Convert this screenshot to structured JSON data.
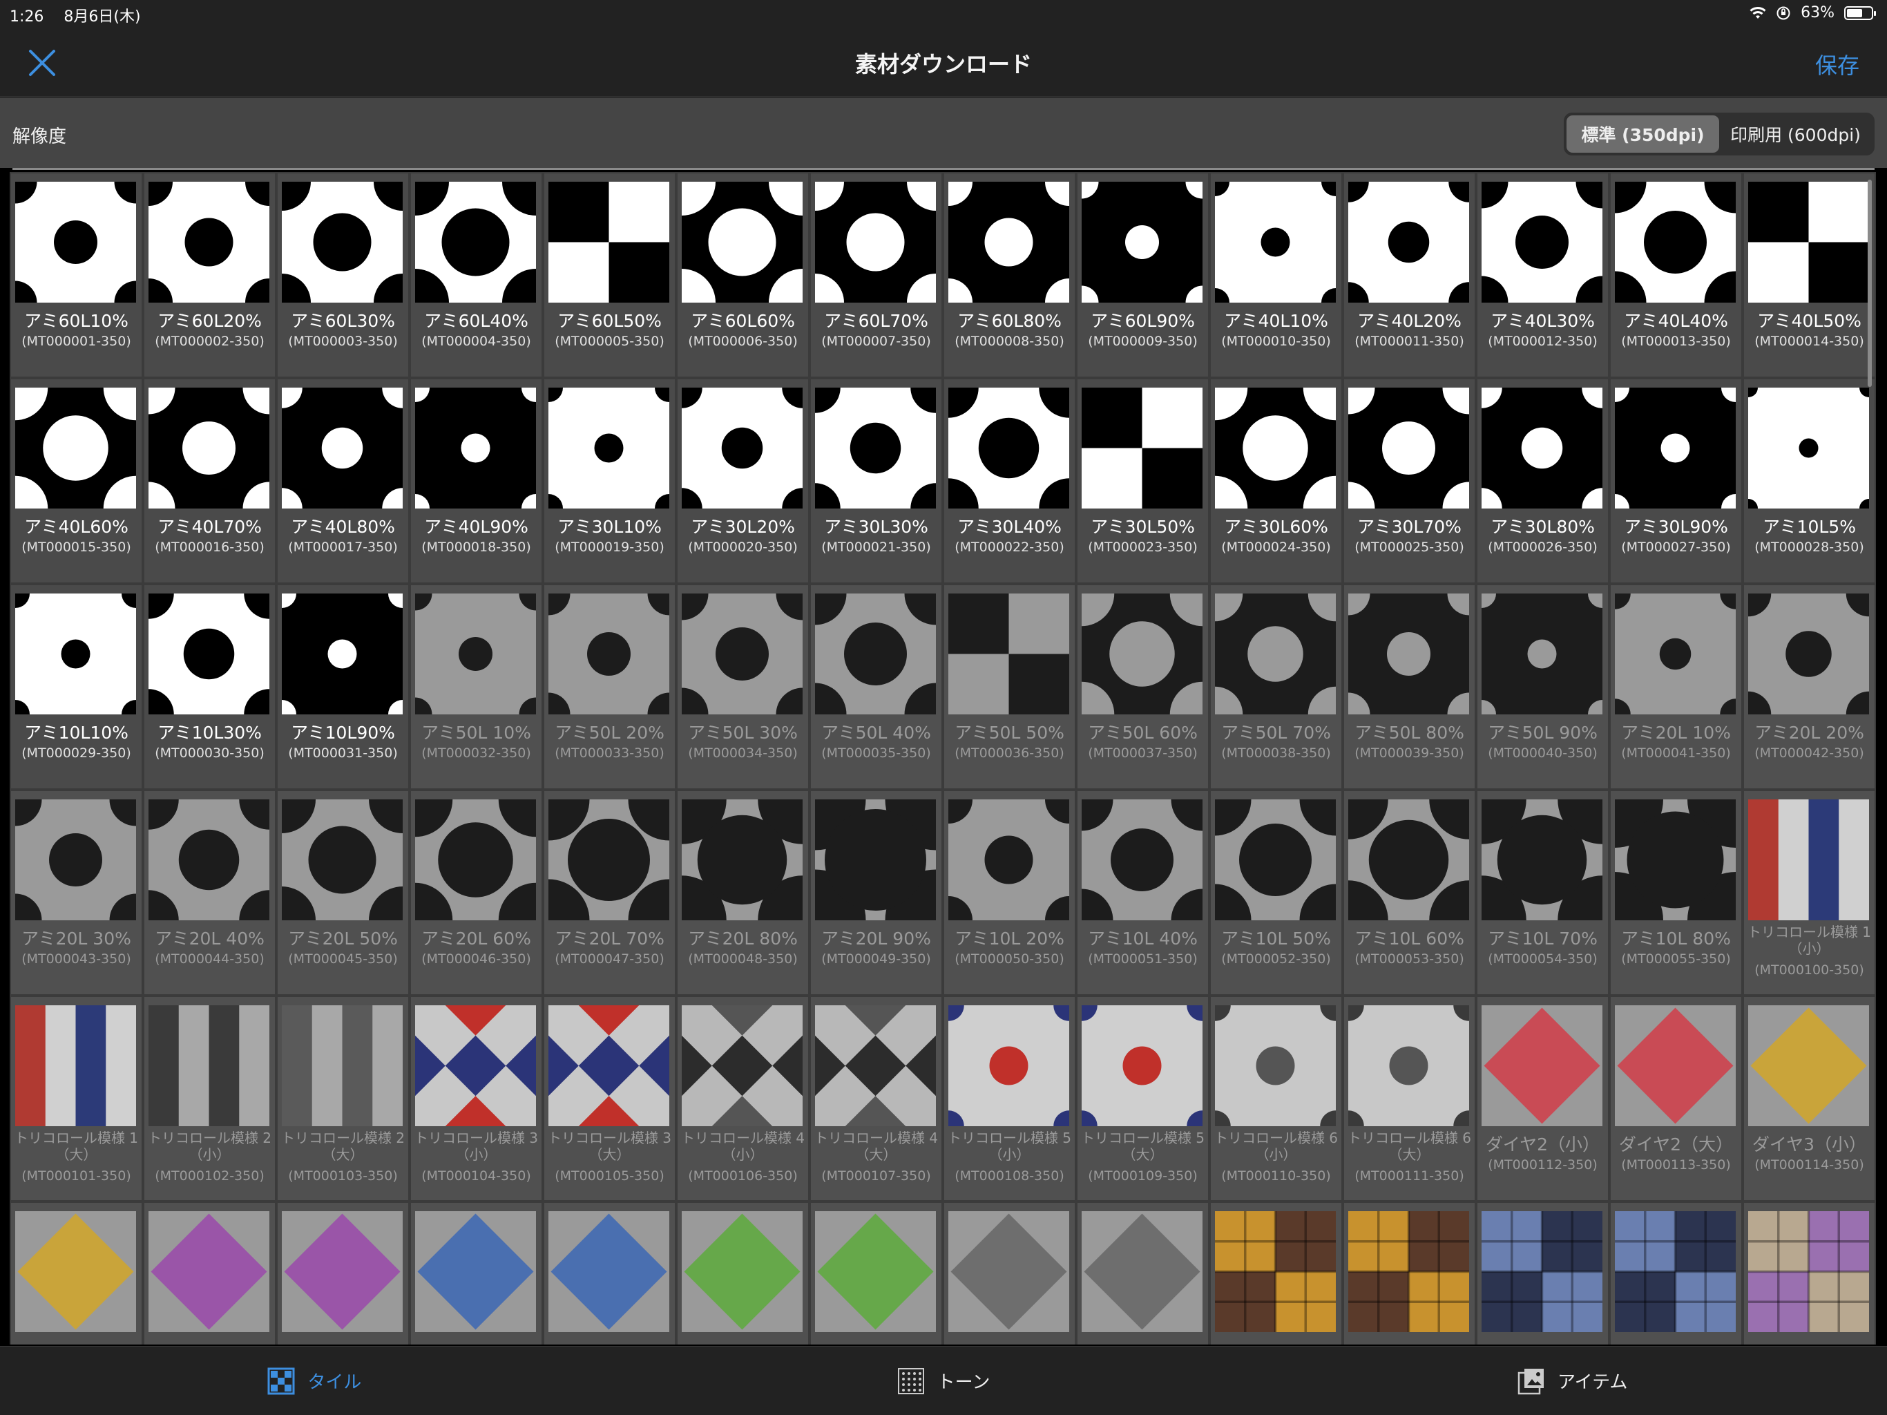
{
  "status": {
    "time": "1:26",
    "date": "8月6日(木)",
    "battery": "63%"
  },
  "nav": {
    "title": "素材ダウンロード",
    "save": "保存"
  },
  "resolution": {
    "label": "解像度",
    "options": [
      "標準 (350dpi)",
      "印刷用 (600dpi)"
    ],
    "selected": 0
  },
  "tabs": [
    {
      "label": "タイル",
      "icon": "tile-icon",
      "active": true
    },
    {
      "label": "トーン",
      "icon": "tone-icon",
      "active": false
    },
    {
      "label": "アイテム",
      "icon": "item-icon",
      "active": false
    }
  ],
  "tiles": [
    {
      "name": "アミ60L10%",
      "code": "(MT000001-350)",
      "p": "ami",
      "bg": "#fff",
      "fg": "#000",
      "r": 0.18,
      "dim": false
    },
    {
      "name": "アミ60L20%",
      "code": "(MT000002-350)",
      "p": "ami",
      "bg": "#fff",
      "fg": "#000",
      "r": 0.2,
      "dim": false
    },
    {
      "name": "アミ60L30%",
      "code": "(MT000003-350)",
      "p": "ami",
      "bg": "#fff",
      "fg": "#000",
      "r": 0.24,
      "dim": false
    },
    {
      "name": "アミ60L40%",
      "code": "(MT000004-350)",
      "p": "ami",
      "bg": "#fff",
      "fg": "#000",
      "r": 0.28,
      "dim": false
    },
    {
      "name": "アミ60L50%",
      "code": "(MT000005-350)",
      "p": "check",
      "bg": "#fff",
      "fg": "#000",
      "r": 0,
      "dim": false
    },
    {
      "name": "アミ60L60%",
      "code": "(MT000006-350)",
      "p": "ami",
      "bg": "#000",
      "fg": "#fff",
      "r": 0.28,
      "dim": false
    },
    {
      "name": "アミ60L70%",
      "code": "(MT000007-350)",
      "p": "ami",
      "bg": "#000",
      "fg": "#fff",
      "r": 0.24,
      "dim": false
    },
    {
      "name": "アミ60L80%",
      "code": "(MT000008-350)",
      "p": "ami",
      "bg": "#000",
      "fg": "#fff",
      "r": 0.2,
      "dim": false
    },
    {
      "name": "アミ60L90%",
      "code": "(MT000009-350)",
      "p": "ami",
      "bg": "#000",
      "fg": "#fff",
      "r": 0.14,
      "dim": false
    },
    {
      "name": "アミ40L10%",
      "code": "(MT000010-350)",
      "p": "ami",
      "bg": "#fff",
      "fg": "#000",
      "r": 0.12,
      "dim": false
    },
    {
      "name": "アミ40L20%",
      "code": "(MT000011-350)",
      "p": "ami",
      "bg": "#fff",
      "fg": "#000",
      "r": 0.17,
      "dim": false
    },
    {
      "name": "アミ40L30%",
      "code": "(MT000012-350)",
      "p": "ami",
      "bg": "#fff",
      "fg": "#000",
      "r": 0.22,
      "dim": false
    },
    {
      "name": "アミ40L40%",
      "code": "(MT000013-350)",
      "p": "ami",
      "bg": "#fff",
      "fg": "#000",
      "r": 0.26,
      "dim": false
    },
    {
      "name": "アミ40L50%",
      "code": "(MT000014-350)",
      "p": "check",
      "bg": "#fff",
      "fg": "#000",
      "r": 0,
      "dim": false
    },
    {
      "name": "アミ40L60%",
      "code": "(MT000015-350)",
      "p": "ami",
      "bg": "#000",
      "fg": "#fff",
      "r": 0.27,
      "dim": false
    },
    {
      "name": "アミ40L70%",
      "code": "(MT000016-350)",
      "p": "ami",
      "bg": "#000",
      "fg": "#fff",
      "r": 0.22,
      "dim": false
    },
    {
      "name": "アミ40L80%",
      "code": "(MT000017-350)",
      "p": "ami",
      "bg": "#000",
      "fg": "#fff",
      "r": 0.17,
      "dim": false
    },
    {
      "name": "アミ40L90%",
      "code": "(MT000018-350)",
      "p": "ami",
      "bg": "#000",
      "fg": "#fff",
      "r": 0.12,
      "dim": false
    },
    {
      "name": "アミ30L10%",
      "code": "(MT000019-350)",
      "p": "ami",
      "bg": "#fff",
      "fg": "#000",
      "r": 0.12,
      "dim": false
    },
    {
      "name": "アミ30L20%",
      "code": "(MT000020-350)",
      "p": "ami",
      "bg": "#fff",
      "fg": "#000",
      "r": 0.17,
      "dim": false
    },
    {
      "name": "アミ30L30%",
      "code": "(MT000021-350)",
      "p": "ami",
      "bg": "#fff",
      "fg": "#000",
      "r": 0.21,
      "dim": false
    },
    {
      "name": "アミ30L40%",
      "code": "(MT000022-350)",
      "p": "ami",
      "bg": "#fff",
      "fg": "#000",
      "r": 0.25,
      "dim": false
    },
    {
      "name": "アミ30L50%",
      "code": "(MT000023-350)",
      "p": "check",
      "bg": "#fff",
      "fg": "#000",
      "r": 0,
      "dim": false
    },
    {
      "name": "アミ30L60%",
      "code": "(MT000024-350)",
      "p": "ami",
      "bg": "#000",
      "fg": "#fff",
      "r": 0.27,
      "dim": false
    },
    {
      "name": "アミ30L70%",
      "code": "(MT000025-350)",
      "p": "ami",
      "bg": "#000",
      "fg": "#fff",
      "r": 0.22,
      "dim": false
    },
    {
      "name": "アミ30L80%",
      "code": "(MT000026-350)",
      "p": "ami",
      "bg": "#000",
      "fg": "#fff",
      "r": 0.17,
      "dim": false
    },
    {
      "name": "アミ30L90%",
      "code": "(MT000027-350)",
      "p": "ami",
      "bg": "#000",
      "fg": "#fff",
      "r": 0.12,
      "dim": false
    },
    {
      "name": "アミ10L5%",
      "code": "(MT000028-350)",
      "p": "ami",
      "bg": "#fff",
      "fg": "#000",
      "r": 0.08,
      "dim": false
    },
    {
      "name": "アミ10L10%",
      "code": "(MT000029-350)",
      "p": "ami",
      "bg": "#fff",
      "fg": "#000",
      "r": 0.12,
      "dim": false
    },
    {
      "name": "アミ10L30%",
      "code": "(MT000030-350)",
      "p": "ami",
      "bg": "#fff",
      "fg": "#000",
      "r": 0.21,
      "dim": false
    },
    {
      "name": "アミ10L90%",
      "code": "(MT000031-350)",
      "p": "ami",
      "bg": "#000",
      "fg": "#fff",
      "r": 0.12,
      "dim": false
    },
    {
      "name": "アミ50L 10%",
      "code": "(MT000032-350)",
      "p": "ami",
      "bg": "#9a9a9a",
      "fg": "#1c1c1c",
      "r": 0.14,
      "dim": true
    },
    {
      "name": "アミ50L 20%",
      "code": "(MT000033-350)",
      "p": "ami",
      "bg": "#9a9a9a",
      "fg": "#1c1c1c",
      "r": 0.18,
      "dim": true
    },
    {
      "name": "アミ50L 30%",
      "code": "(MT000034-350)",
      "p": "ami",
      "bg": "#9a9a9a",
      "fg": "#1c1c1c",
      "r": 0.22,
      "dim": true
    },
    {
      "name": "アミ50L 40%",
      "code": "(MT000035-350)",
      "p": "ami",
      "bg": "#9a9a9a",
      "fg": "#1c1c1c",
      "r": 0.26,
      "dim": true
    },
    {
      "name": "アミ50L 50%",
      "code": "(MT000036-350)",
      "p": "check",
      "bg": "#9a9a9a",
      "fg": "#1c1c1c",
      "r": 0,
      "dim": true
    },
    {
      "name": "アミ50L 60%",
      "code": "(MT000037-350)",
      "p": "ami",
      "bg": "#1c1c1c",
      "fg": "#9a9a9a",
      "r": 0.27,
      "dim": true
    },
    {
      "name": "アミ50L 70%",
      "code": "(MT000038-350)",
      "p": "ami",
      "bg": "#1c1c1c",
      "fg": "#9a9a9a",
      "r": 0.23,
      "dim": true
    },
    {
      "name": "アミ50L 80%",
      "code": "(MT000039-350)",
      "p": "ami",
      "bg": "#1c1c1c",
      "fg": "#9a9a9a",
      "r": 0.18,
      "dim": true
    },
    {
      "name": "アミ50L 90%",
      "code": "(MT000040-350)",
      "p": "ami",
      "bg": "#1c1c1c",
      "fg": "#9a9a9a",
      "r": 0.12,
      "dim": true
    },
    {
      "name": "アミ20L 10%",
      "code": "(MT000041-350)",
      "p": "ami",
      "bg": "#9a9a9a",
      "fg": "#1c1c1c",
      "r": 0.13,
      "dim": true
    },
    {
      "name": "アミ20L 20%",
      "code": "(MT000042-350)",
      "p": "ami",
      "bg": "#9a9a9a",
      "fg": "#1c1c1c",
      "r": 0.19,
      "dim": true
    },
    {
      "name": "アミ20L 30%",
      "code": "(MT000043-350)",
      "p": "ami",
      "bg": "#9a9a9a",
      "fg": "#1c1c1c",
      "r": 0.22,
      "dim": true
    },
    {
      "name": "アミ20L 40%",
      "code": "(MT000044-350)",
      "p": "ami",
      "bg": "#9a9a9a",
      "fg": "#1c1c1c",
      "r": 0.25,
      "dim": true
    },
    {
      "name": "アミ20L 50%",
      "code": "(MT000045-350)",
      "p": "ami",
      "bg": "#9a9a9a",
      "fg": "#1c1c1c",
      "r": 0.28,
      "dim": true
    },
    {
      "name": "アミ20L 60%",
      "code": "(MT000046-350)",
      "p": "ami",
      "bg": "#9a9a9a",
      "fg": "#1c1c1c",
      "r": 0.31,
      "dim": true
    },
    {
      "name": "アミ20L 70%",
      "code": "(MT000047-350)",
      "p": "ami",
      "bg": "#9a9a9a",
      "fg": "#1c1c1c",
      "r": 0.34,
      "dim": true
    },
    {
      "name": "アミ20L 80%",
      "code": "(MT000048-350)",
      "p": "ami",
      "bg": "#9a9a9a",
      "fg": "#1c1c1c",
      "r": 0.37,
      "dim": true
    },
    {
      "name": "アミ20L 90%",
      "code": "(MT000049-350)",
      "p": "ami",
      "bg": "#9a9a9a",
      "fg": "#1c1c1c",
      "r": 0.42,
      "dim": true
    },
    {
      "name": "アミ10L 20%",
      "code": "(MT000050-350)",
      "p": "ami",
      "bg": "#9a9a9a",
      "fg": "#1c1c1c",
      "r": 0.2,
      "dim": true
    },
    {
      "name": "アミ10L 40%",
      "code": "(MT000051-350)",
      "p": "ami",
      "bg": "#9a9a9a",
      "fg": "#1c1c1c",
      "r": 0.26,
      "dim": true
    },
    {
      "name": "アミ10L 50%",
      "code": "(MT000052-350)",
      "p": "ami",
      "bg": "#9a9a9a",
      "fg": "#1c1c1c",
      "r": 0.3,
      "dim": true
    },
    {
      "name": "アミ10L 60%",
      "code": "(MT000053-350)",
      "p": "ami",
      "bg": "#9a9a9a",
      "fg": "#1c1c1c",
      "r": 0.33,
      "dim": true
    },
    {
      "name": "アミ10L 70%",
      "code": "(MT000054-350)",
      "p": "ami",
      "bg": "#9a9a9a",
      "fg": "#1c1c1c",
      "r": 0.37,
      "dim": true
    },
    {
      "name": "アミ10L 80%",
      "code": "(MT000055-350)",
      "p": "ami",
      "bg": "#9a9a9a",
      "fg": "#1c1c1c",
      "r": 0.4,
      "dim": true
    },
    {
      "name": "トリコロール模様 1（小）",
      "code": "(MT000100-350)",
      "p": "stripes",
      "c1": "#b03a32",
      "c2": "#d0d0d0",
      "c3": "#2c3a78",
      "dim": true
    },
    {
      "name": "トリコロール模様 1（大）",
      "code": "(MT000101-350)",
      "p": "stripes",
      "c1": "#b03a32",
      "c2": "#d0d0d0",
      "c3": "#2c3a78",
      "dim": true
    },
    {
      "name": "トリコロール模様 2（小）",
      "code": "(MT000102-350)",
      "p": "stripes",
      "c1": "#3a3a3a",
      "c2": "#a8a8a8",
      "c3": "#3a3a3a",
      "dim": true
    },
    {
      "name": "トリコロール模様 2（大）",
      "code": "(MT000103-350)",
      "p": "stripes",
      "c1": "#5a5a5a",
      "c2": "#a8a8a8",
      "c3": "#5a5a5a",
      "dim": true
    },
    {
      "name": "トリコロール模様 3（小）",
      "code": "(MT000104-350)",
      "p": "diamond",
      "c1": "#c0302a",
      "c2": "#c8c8c8",
      "c3": "#2b3478",
      "dim": true
    },
    {
      "name": "トリコロール模様 3（大）",
      "code": "(MT000105-350)",
      "p": "diamond",
      "c1": "#c0302a",
      "c2": "#c8c8c8",
      "c3": "#2b3478",
      "dim": true
    },
    {
      "name": "トリコロール模様 4（小）",
      "code": "(MT000106-350)",
      "p": "diamond",
      "c1": "#555",
      "c2": "#b8b8b8",
      "c3": "#2c2c2c",
      "dim": true
    },
    {
      "name": "トリコロール模様 4（大）",
      "code": "(MT000107-350)",
      "p": "diamond",
      "c1": "#555",
      "c2": "#b8b8b8",
      "c3": "#2c2c2c",
      "dim": true
    },
    {
      "name": "トリコロール模様 5（小）",
      "code": "(MT000108-350)",
      "p": "dot",
      "c1": "#2b3478",
      "c2": "#cfcfcf",
      "c3": "#c0302a",
      "dim": true
    },
    {
      "name": "トリコロール模様 5（大）",
      "code": "(MT000109-350)",
      "p": "dot",
      "c1": "#2b3478",
      "c2": "#cfcfcf",
      "c3": "#c0302a",
      "dim": true
    },
    {
      "name": "トリコロール模様 6（小）",
      "code": "(MT000110-350)",
      "p": "dot",
      "c1": "#3a3a3a",
      "c2": "#c8c8c8",
      "c3": "#555",
      "dim": true
    },
    {
      "name": "トリコロール模様 6（大）",
      "code": "(MT000111-350)",
      "p": "dot",
      "c1": "#3a3a3a",
      "c2": "#c8c8c8",
      "c3": "#555",
      "dim": true
    },
    {
      "name": "ダイヤ2（小）",
      "code": "(MT000112-350)",
      "p": "rhombus",
      "c1": "#c94b55",
      "c2": "#9a9a9a",
      "dim": true
    },
    {
      "name": "ダイヤ2（大）",
      "code": "(MT000113-350)",
      "p": "rhombus",
      "c1": "#c94b55",
      "c2": "#9a9a9a",
      "dim": true
    },
    {
      "name": "ダイヤ3（小）",
      "code": "(MT000114-350)",
      "p": "rhombus",
      "c1": "#c9a43a",
      "c2": "#9a9a9a",
      "dim": true
    },
    {
      "name": "",
      "code": "",
      "p": "rhombus",
      "c1": "#c9a43a",
      "c2": "#9a9a9a",
      "dim": true
    },
    {
      "name": "",
      "code": "",
      "p": "rhombus",
      "c1": "#9a55a8",
      "c2": "#9a9a9a",
      "dim": true
    },
    {
      "name": "",
      "code": "",
      "p": "rhombus",
      "c1": "#9a55a8",
      "c2": "#9a9a9a",
      "dim": true
    },
    {
      "name": "",
      "code": "",
      "p": "rhombus",
      "c1": "#4a6fb0",
      "c2": "#9a9a9a",
      "dim": true
    },
    {
      "name": "",
      "code": "",
      "p": "rhombus",
      "c1": "#4a6fb0",
      "c2": "#9a9a9a",
      "dim": true
    },
    {
      "name": "",
      "code": "",
      "p": "rhombus",
      "c1": "#66a84a",
      "c2": "#9a9a9a",
      "dim": true
    },
    {
      "name": "",
      "code": "",
      "p": "rhombus",
      "c1": "#66a84a",
      "c2": "#9a9a9a",
      "dim": true
    },
    {
      "name": "",
      "code": "",
      "p": "rhombus",
      "c1": "#6e6e6e",
      "c2": "#9a9a9a",
      "dim": true
    },
    {
      "name": "",
      "code": "",
      "p": "rhombus",
      "c1": "#6e6e6e",
      "c2": "#9a9a9a",
      "dim": true
    },
    {
      "name": "",
      "code": "",
      "p": "plaid",
      "c1": "#c8922e",
      "c2": "#5a3a2a",
      "dim": true
    },
    {
      "name": "",
      "code": "",
      "p": "plaid",
      "c1": "#c8922e",
      "c2": "#5a3a2a",
      "dim": true
    },
    {
      "name": "",
      "code": "",
      "p": "plaid",
      "c1": "#6a7fb0",
      "c2": "#2c3450",
      "dim": true
    },
    {
      "name": "",
      "code": "",
      "p": "plaid",
      "c1": "#6a7fb0",
      "c2": "#2c3450",
      "dim": true
    },
    {
      "name": "",
      "code": "",
      "p": "plaid",
      "c1": "#b8a890",
      "c2": "#9a70b0",
      "dim": true
    }
  ]
}
